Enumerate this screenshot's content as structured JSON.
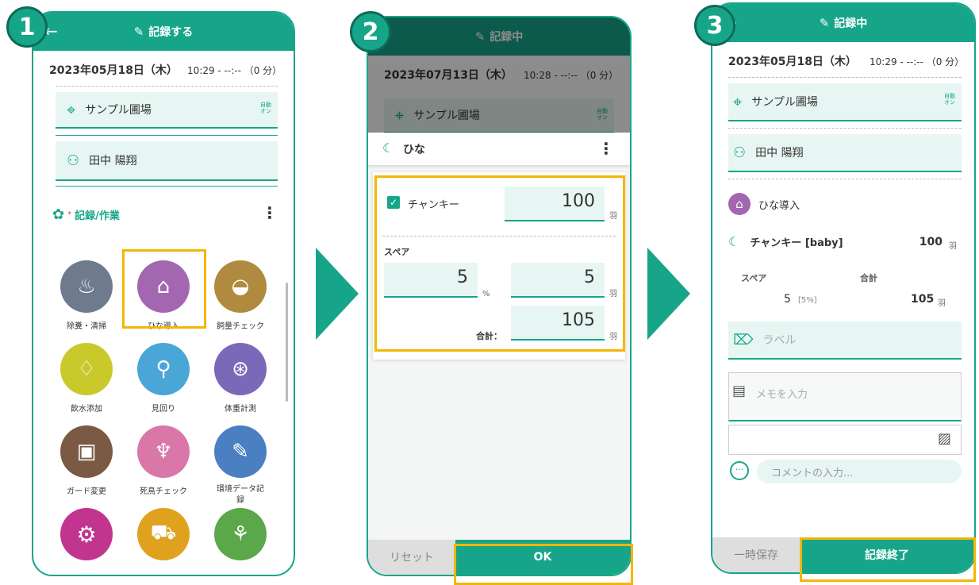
{
  "steps": [
    "1",
    "2",
    "3"
  ],
  "colors": {
    "accent": "#17a589",
    "highlight": "#f2b705"
  },
  "screen1": {
    "title": "記録する",
    "date": "2023年05月18日（木）",
    "time": "10:29 - --:-- （0 分）",
    "farm": "サンプル圃場",
    "auto_label": "自動\nオン",
    "user": "田中 陽翔",
    "section": "記録/作業",
    "items": [
      {
        "label": "除糞・清掃",
        "icon": "cleaning-icon",
        "color": "#6f7b8c"
      },
      {
        "label": "ひな導入",
        "icon": "chick-house-icon",
        "color": "#a367b1"
      },
      {
        "label": "飼量チェック",
        "icon": "feed-bowl-icon",
        "color": "#b08a3e"
      },
      {
        "label": "飲水添加",
        "icon": "water-drop-icon",
        "color": "#c9c92b"
      },
      {
        "label": "見回り",
        "icon": "magnifier-icon",
        "color": "#4aa6d6"
      },
      {
        "label": "体重計測",
        "icon": "scale-icon",
        "color": "#7a68b8"
      },
      {
        "label": "ガード変更",
        "icon": "guard-icon",
        "color": "#7a5a45"
      },
      {
        "label": "死鳥チェック",
        "icon": "dead-bird-icon",
        "color": "#d977a8"
      },
      {
        "label": "環境データ記録",
        "icon": "thermometer-icon",
        "color": "#4a7fc1"
      },
      {
        "label": "",
        "icon": "gear-icon",
        "color": "#c2358f"
      },
      {
        "label": "",
        "icon": "truck-icon",
        "color": "#e0a21e"
      },
      {
        "label": "",
        "icon": "walking-icon",
        "color": "#5aa84a"
      }
    ]
  },
  "screen2": {
    "title": "記録中",
    "date": "2023年07月13日（木）",
    "time": "10:28 - --:-- （0 分）",
    "farm": "サンプル圃場",
    "auto_label": "自動\nオン",
    "panel_title": "ひな",
    "breed": "チャンキー",
    "count": "100",
    "unit": "羽",
    "spare_label": "スペア",
    "spare_percent": "5",
    "percent_unit": "%",
    "spare_count": "5",
    "total_label": "合計：",
    "total": "105",
    "reset": "リセット",
    "ok": "OK"
  },
  "screen3": {
    "title": "記録中",
    "date": "2023年05月18日（木）",
    "time": "10:29 - --:-- （0 分）",
    "farm": "サンプル圃場",
    "auto_label": "自動\nオン",
    "user": "田中 陽翔",
    "task": "ひな導入",
    "breed": "チャンキー [baby]",
    "count": "100",
    "unit": "羽",
    "spare_label": "スペア",
    "total_label": "合計",
    "spare_value": "5",
    "spare_pct": "[5%]",
    "total": "105",
    "label_placeholder": "ラベル",
    "memo_placeholder": "メモを入力",
    "comment_placeholder": "コメントの入力...",
    "save_temp": "一時保存",
    "finish": "記録終了"
  }
}
